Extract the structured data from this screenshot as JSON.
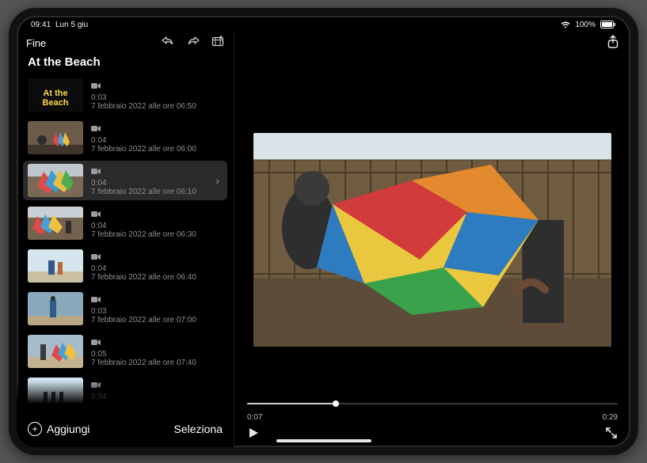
{
  "status": {
    "time": "09:41",
    "date": "Lun 5 giu",
    "battery": "100%"
  },
  "toolbar": {
    "done_label": "Fine"
  },
  "project": {
    "title": "At the Beach"
  },
  "sidebar": {
    "add_label": "Aggiungi",
    "select_label": "Seleziona"
  },
  "clips": [
    {
      "duration": "0:03",
      "date": "7 febbraio 2022 alle ore 06:50",
      "selected": false,
      "title_overlay": "At the Beach"
    },
    {
      "duration": "0:04",
      "date": "7 febbraio 2022 alle ore 06:00",
      "selected": false
    },
    {
      "duration": "0:04",
      "date": "7 febbraio 2022 alle ore 06:10",
      "selected": true
    },
    {
      "duration": "0:04",
      "date": "7 febbraio 2022 alle ore 06:30",
      "selected": false
    },
    {
      "duration": "0:04",
      "date": "7 febbraio 2022 alle ore 06:40",
      "selected": false
    },
    {
      "duration": "0:03",
      "date": "7 febbraio 2022 alle ore 07:00",
      "selected": false
    },
    {
      "duration": "0:05",
      "date": "7 febbraio 2022 alle ore 07:40",
      "selected": false
    },
    {
      "duration": "0:04",
      "date": "7 febbraio 2022 …",
      "selected": false
    }
  ],
  "player": {
    "current_time": "0:07",
    "total_time": "0:29",
    "progress_percent": 24
  }
}
